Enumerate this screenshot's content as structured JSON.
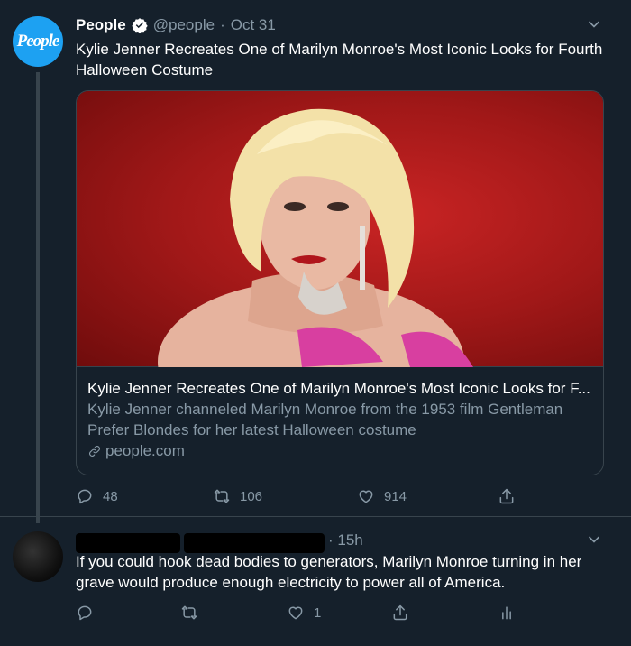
{
  "tweet1": {
    "avatar_text": "People",
    "name": "People",
    "handle": "@people",
    "separator": "·",
    "date": "Oct 31",
    "text": "Kylie Jenner Recreates One of Marilyn Monroe's Most Iconic Looks for Fourth Halloween Costume",
    "card": {
      "title": "Kylie Jenner Recreates One of Marilyn Monroe's Most Iconic Looks for F...",
      "description": "Kylie Jenner channeled Marilyn Monroe from the 1953 film Gentleman Prefer Blondes for her latest Halloween costume",
      "domain": "people.com"
    },
    "actions": {
      "replies": "48",
      "retweets": "106",
      "likes": "914"
    }
  },
  "tweet2": {
    "time": "· 15h",
    "text": "If you could hook dead bodies to generators, Marilyn Monroe turning in her grave would produce enough electricity to power all of America.",
    "actions": {
      "replies": "",
      "retweets": "",
      "likes": "1"
    }
  },
  "icons": [
    "verified-badge-icon",
    "chevron-down-icon",
    "reply-icon",
    "retweet-icon",
    "like-icon",
    "share-icon",
    "analytics-icon",
    "link-icon"
  ],
  "colors": {
    "background": "#15202b",
    "muted": "#8899a6",
    "accent": "#1da1f2",
    "border": "#38444d",
    "card_bg": "#b71c1c"
  }
}
